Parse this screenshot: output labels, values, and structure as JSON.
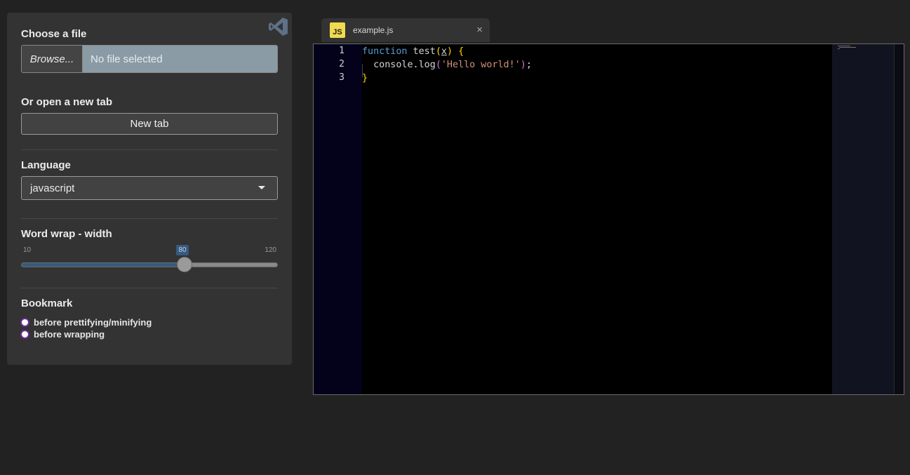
{
  "sidebar": {
    "file": {
      "label": "Choose a file",
      "browse_label": "Browse...",
      "status": "No file selected"
    },
    "newtab": {
      "label": "Or open a new tab",
      "button_label": "New tab"
    },
    "language": {
      "label": "Language",
      "selected": "javascript"
    },
    "wrap": {
      "label": "Word wrap - width",
      "min": "10",
      "max": "120",
      "value": "80",
      "fraction": 0.636
    },
    "bookmark": {
      "label": "Bookmark",
      "options": [
        "before prettifying/minifying",
        "before wrapping"
      ]
    }
  },
  "editor": {
    "tab": {
      "icon_text": "JS",
      "filename": "example.js",
      "close": "×"
    },
    "line_numbers": [
      "1",
      "2",
      "3"
    ],
    "lines": [
      [
        {
          "t": "function",
          "c": "kw"
        },
        {
          "t": " test",
          "c": ""
        },
        {
          "t": "(",
          "c": "br"
        },
        {
          "t": "x",
          "c": "param"
        },
        {
          "t": ")",
          "c": "br"
        },
        {
          "t": " ",
          "c": ""
        },
        {
          "t": "{",
          "c": "br"
        }
      ],
      [
        {
          "t": "  console.log",
          "c": ""
        },
        {
          "t": "(",
          "c": "br2"
        },
        {
          "t": "'Hello world!'",
          "c": "str"
        },
        {
          "t": ")",
          "c": "br2"
        },
        {
          "t": ";",
          "c": ""
        }
      ],
      [
        {
          "t": "}",
          "c": "br"
        }
      ]
    ]
  },
  "colors": {
    "accent": "#375a7f",
    "radio_border": "#6b2c91",
    "js_badge": "#f0db4f"
  },
  "icons": {
    "logo": "vscode-icon",
    "close": "close-icon",
    "dropdown": "caret-down-icon"
  }
}
